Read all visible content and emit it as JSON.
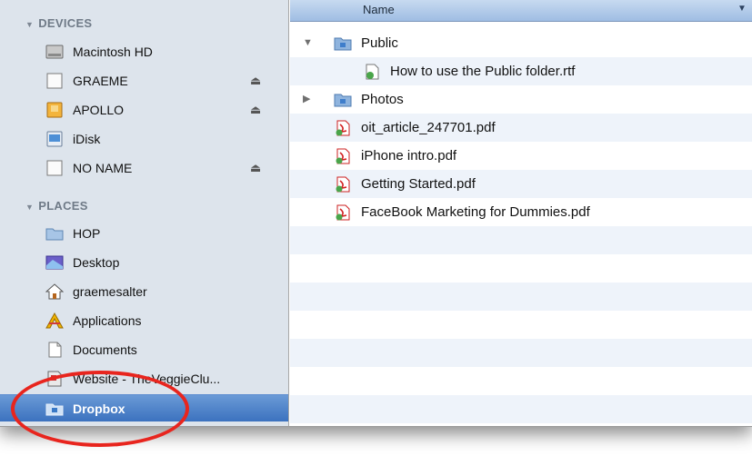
{
  "sidebar": {
    "devices_header": "DEVICES",
    "places_header": "PLACES",
    "devices": [
      {
        "label": "Macintosh HD",
        "icon": "hard-drive-icon",
        "eject": false
      },
      {
        "label": "GRAEME",
        "icon": "external-drive-icon",
        "eject": true
      },
      {
        "label": "APOLLO",
        "icon": "disk-image-icon",
        "eject": true
      },
      {
        "label": "iDisk",
        "icon": "idisk-icon",
        "eject": false
      },
      {
        "label": "NO NAME",
        "icon": "external-drive-icon",
        "eject": true
      }
    ],
    "places": [
      {
        "label": "HOP",
        "icon": "folder-icon"
      },
      {
        "label": "Desktop",
        "icon": "desktop-icon"
      },
      {
        "label": "graemesalter",
        "icon": "home-icon"
      },
      {
        "label": "Applications",
        "icon": "applications-icon"
      },
      {
        "label": "Documents",
        "icon": "documents-icon"
      },
      {
        "label": "Website - TheVeggieClu...",
        "icon": "website-folder-icon"
      },
      {
        "label": "Dropbox",
        "icon": "dropbox-folder-icon",
        "selected": true
      }
    ],
    "eject_glyph": "⏏"
  },
  "list": {
    "column_name": "Name",
    "sort_glyph": "▼",
    "rows": [
      {
        "name": "Public",
        "type": "folder",
        "disclosure": "▼",
        "indent": 0
      },
      {
        "name": "How to use the Public folder.rtf",
        "type": "rtf",
        "disclosure": "",
        "indent": 1
      },
      {
        "name": "Photos",
        "type": "folder",
        "disclosure": "▶",
        "indent": 0
      },
      {
        "name": "oit_article_247701.pdf",
        "type": "pdf",
        "disclosure": "",
        "indent": 0
      },
      {
        "name": "iPhone intro.pdf",
        "type": "pdf",
        "disclosure": "",
        "indent": 0
      },
      {
        "name": "Getting Started.pdf",
        "type": "pdf",
        "disclosure": "",
        "indent": 0
      },
      {
        "name": "FaceBook Marketing for Dummies.pdf",
        "type": "pdf",
        "disclosure": "",
        "indent": 0
      }
    ]
  },
  "colors": {
    "sidebar_bg": "#dde4ec",
    "selection": "#3c72bf",
    "annotation": "#e8251e"
  }
}
